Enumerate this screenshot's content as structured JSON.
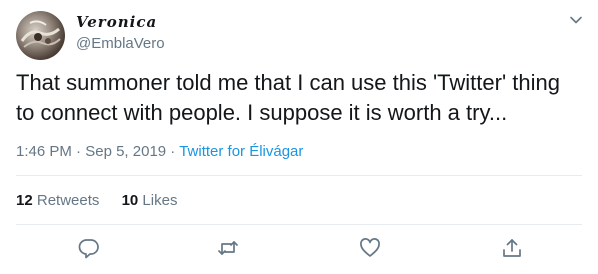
{
  "user": {
    "display_name": "Veronica",
    "handle": "@EmblaVero"
  },
  "tweet": {
    "text": "That summoner told me that I can use this 'Twitter' thing to connect with people. I suppose it is worth a try...",
    "time": "1:46 PM",
    "separator1": " · ",
    "date": "Sep 5, 2019",
    "separator2": " · ",
    "source": "Twitter for Élivágar"
  },
  "stats": {
    "retweets_count": "12",
    "retweets_label": "Retweets",
    "likes_count": "10",
    "likes_label": "Likes"
  },
  "icons": {
    "caret": "chevron-down-icon",
    "reply": "reply-icon",
    "retweet": "retweet-icon",
    "like": "heart-icon",
    "share": "share-icon"
  },
  "colors": {
    "text": "#14171a",
    "secondary": "#657786",
    "link": "#1b95e0",
    "divider": "#e6ecf0"
  }
}
